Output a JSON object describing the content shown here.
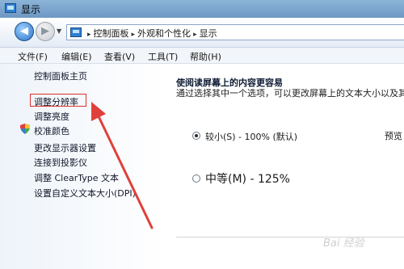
{
  "window": {
    "title": "显示"
  },
  "navigation": {
    "back_glyph": "◀",
    "forward_glyph": "▶",
    "history_glyph": "▼",
    "breadcrumb_sep": "▸",
    "breadcrumbs": [
      "控制面板",
      "外观和个性化",
      "显示"
    ]
  },
  "menu": {
    "items": [
      "文件(F)",
      "编辑(E)",
      "查看(V)",
      "工具(T)",
      "帮助(H)"
    ]
  },
  "sidebar": {
    "home_link": "控制面板主页",
    "links": [
      "调整分辨率",
      "调整亮度",
      "校准颜色",
      "更改显示器设置",
      "连接到投影仪",
      "调整 ClearType 文本",
      "设置自定义文本大小(DPI)"
    ]
  },
  "main": {
    "title": "使阅读屏幕上的内容更容易",
    "description": "通过选择其中一个选项，可以更改屏幕上的文本大小以及其",
    "options": [
      {
        "label": "较小(S) - 100% (默认)",
        "selected": true
      },
      {
        "label": "中等(M) - 125%",
        "selected": false
      }
    ],
    "preview_label": "预览"
  },
  "annotation": {
    "arrow_color": "#e0403a",
    "box_color": "#d9322f"
  },
  "watermark": "Bai 经验"
}
